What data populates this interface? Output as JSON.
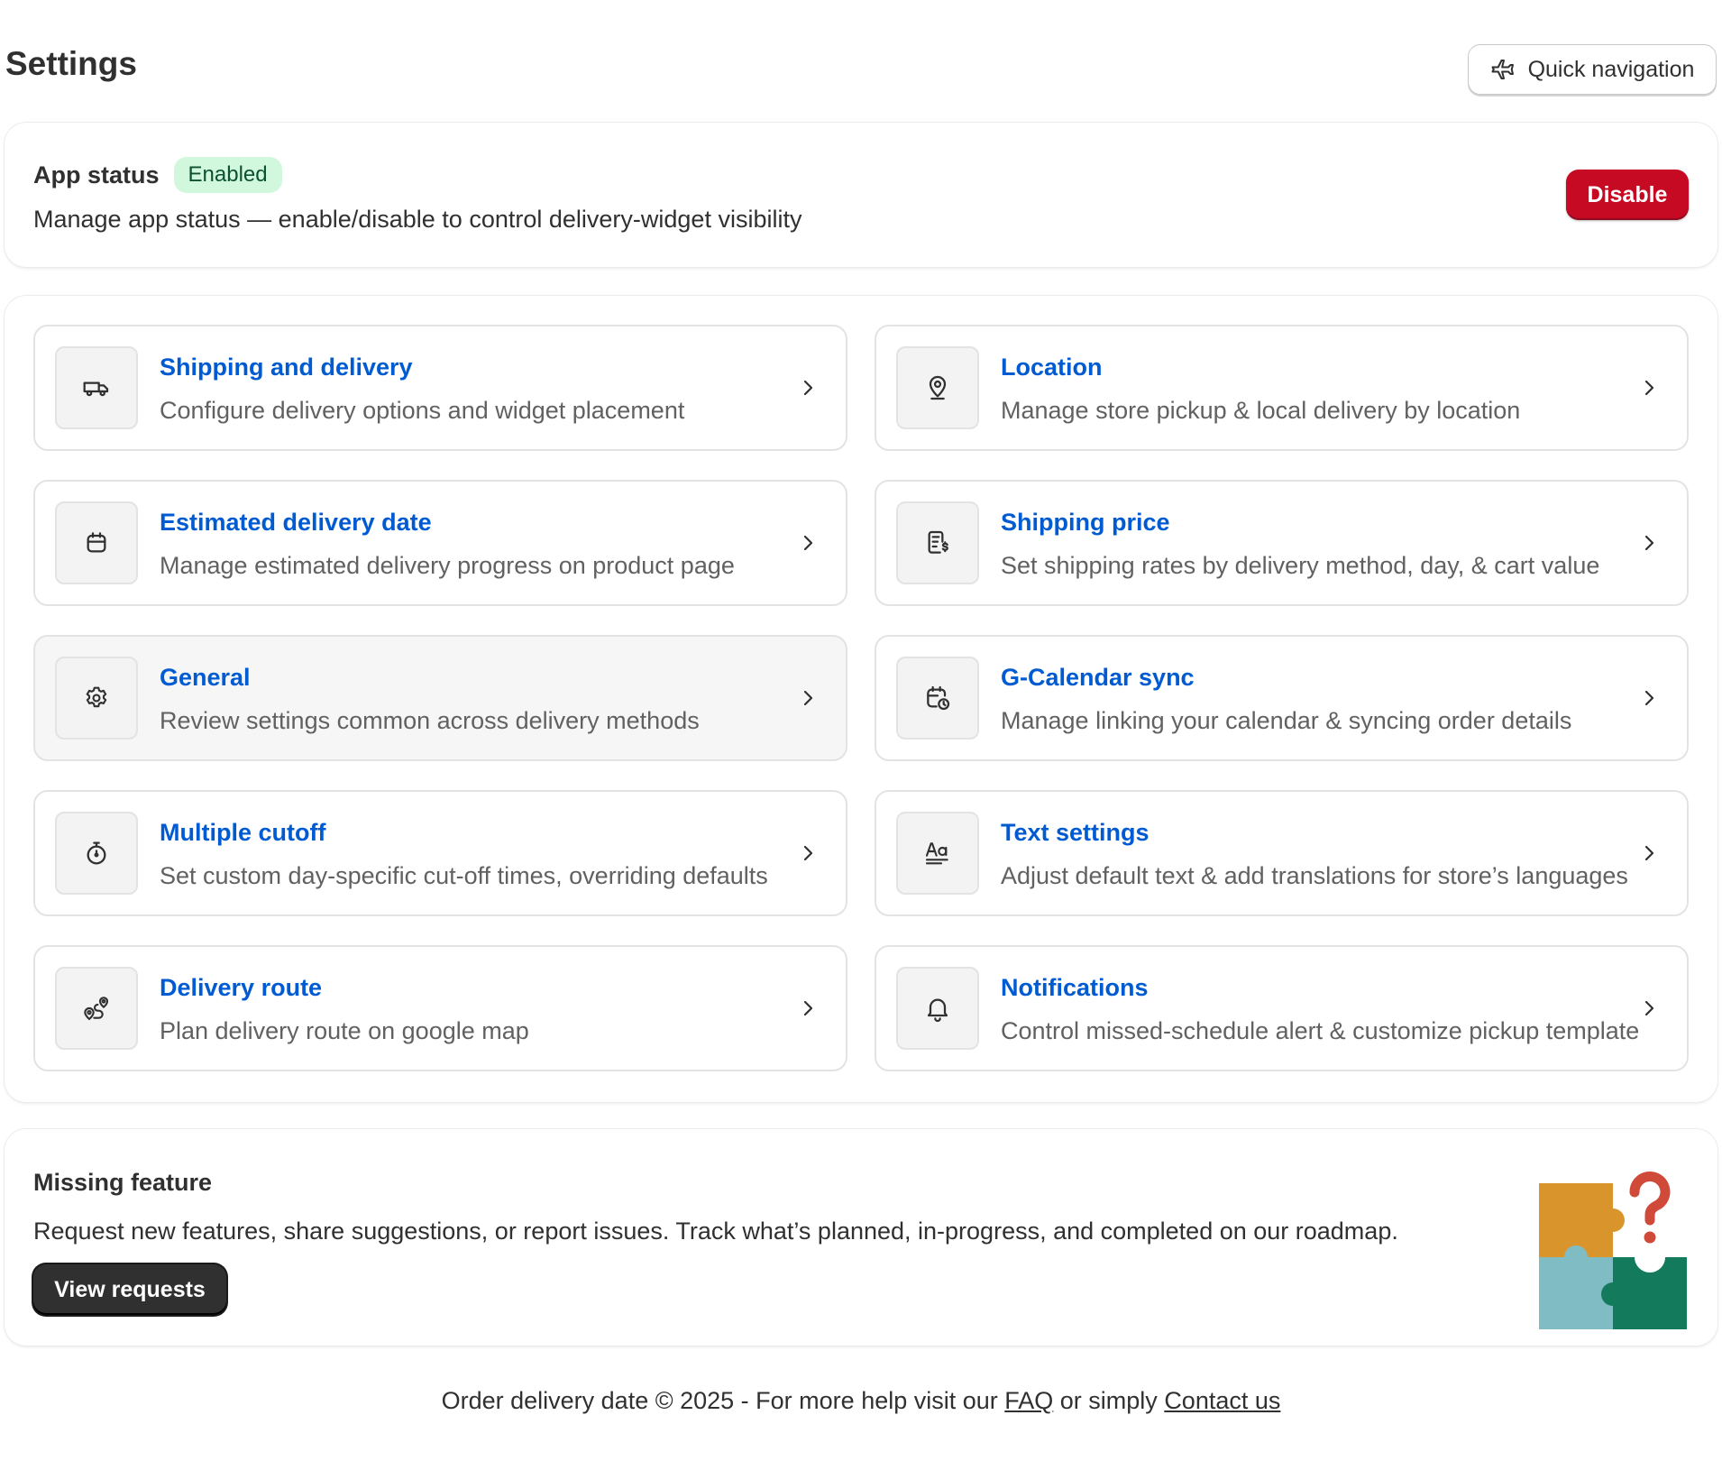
{
  "header": {
    "title": "Settings",
    "quick_nav_label": "Quick navigation"
  },
  "app_status": {
    "title": "App status",
    "badge": "Enabled",
    "description": "Manage app status — enable/disable to control delivery-widget visibility",
    "disable_label": "Disable"
  },
  "tiles": [
    {
      "title": "Shipping and delivery",
      "description": "Configure delivery options and widget placement",
      "icon": "truck-icon"
    },
    {
      "title": "Location",
      "description": "Manage store pickup & local delivery by location",
      "icon": "location-pin-icon"
    },
    {
      "title": "Estimated delivery date",
      "description": "Manage estimated delivery progress on product page",
      "icon": "calendar-icon"
    },
    {
      "title": "Shipping price",
      "description": "Set shipping rates by delivery method, day, & cart value",
      "icon": "receipt-dollar-icon"
    },
    {
      "title": "General",
      "description": "Review settings common across delivery methods",
      "icon": "gear-icon"
    },
    {
      "title": "G-Calendar sync",
      "description": "Manage linking your calendar & syncing order details",
      "icon": "calendar-clock-icon"
    },
    {
      "title": "Multiple cutoff",
      "description": "Set custom day-specific cut-off times, overriding defaults",
      "icon": "stopwatch-icon"
    },
    {
      "title": "Text settings",
      "description": "Adjust default text & add  translations for store’s languages",
      "icon": "text-font-icon"
    },
    {
      "title": "Delivery route",
      "description": "Plan delivery route on google map",
      "icon": "route-icon"
    },
    {
      "title": "Notifications",
      "description": "Control missed-schedule alert & customize pickup template",
      "icon": "bell-icon"
    }
  ],
  "missing_feature": {
    "title": "Missing feature",
    "description": "Request new features, share suggestions, or report issues. Track what’s planned, in-progress, and completed on our roadmap.",
    "button_label": "View requests"
  },
  "footer": {
    "prefix": "Order delivery date © 2025 - For more help visit our ",
    "faq_label": "FAQ",
    "middle": " or simply ",
    "contact_label": "Contact us"
  },
  "colors": {
    "link_blue": "#005bd3",
    "danger_red": "#c70a24",
    "badge_green_bg": "#d1f7dc",
    "puzzle_orange": "#d9952b",
    "puzzle_teal": "#7fbcc4",
    "puzzle_green": "#137a5b",
    "puzzle_red": "#d04a3a"
  }
}
